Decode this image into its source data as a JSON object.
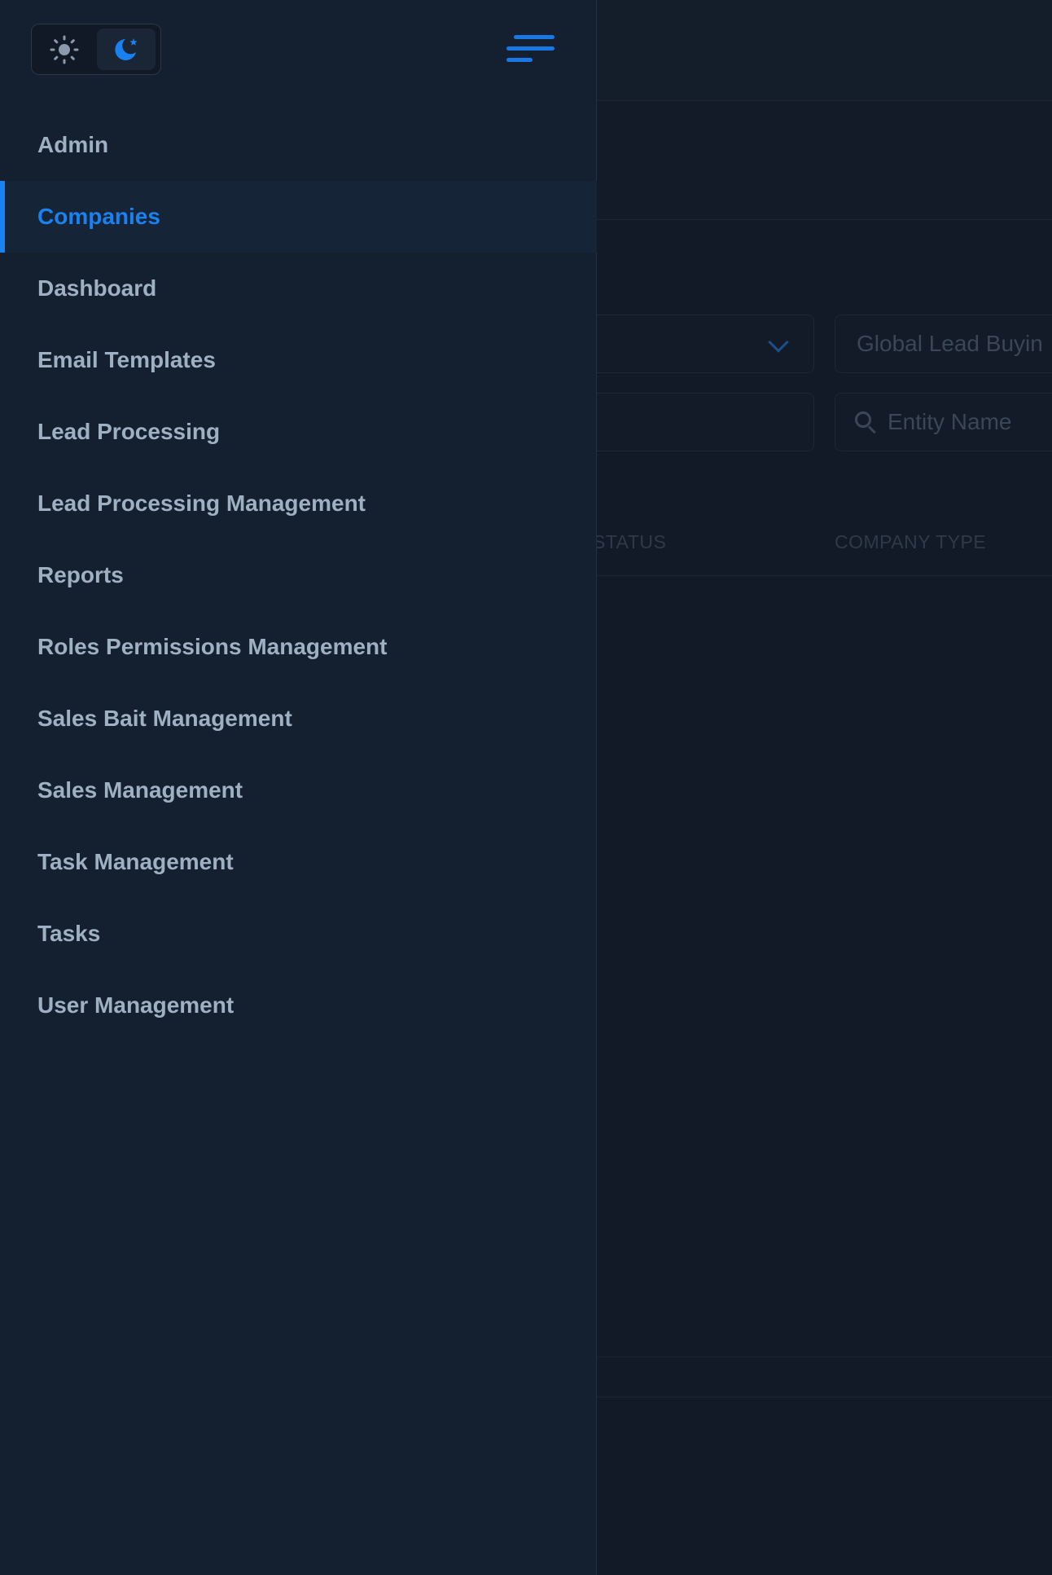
{
  "theme_toggle": {
    "options": [
      {
        "name": "light",
        "icon": "sun-icon",
        "active": false
      },
      {
        "name": "dark",
        "icon": "moon-icon",
        "active": true
      }
    ]
  },
  "menu_toggle": {
    "icon": "hamburger-menu-icon"
  },
  "sidebar": {
    "active_item": "Companies",
    "items": [
      {
        "label": "Admin"
      },
      {
        "label": "Companies"
      },
      {
        "label": "Dashboard"
      },
      {
        "label": "Email Templates"
      },
      {
        "label": "Lead Processing"
      },
      {
        "label": "Lead Processing Management"
      },
      {
        "label": "Reports"
      },
      {
        "label": "Roles Permissions Management"
      },
      {
        "label": "Sales Bait Management"
      },
      {
        "label": "Sales Management"
      },
      {
        "label": "Task Management"
      },
      {
        "label": "Tasks"
      },
      {
        "label": "User Management"
      }
    ]
  },
  "filters": {
    "buyer_value": "Global Lead Buyin",
    "entity_placeholder": "Entity Name"
  },
  "table": {
    "columns": [
      "STATUS",
      "COMPANY TYPE"
    ]
  },
  "colors": {
    "accent": "#1a82f0",
    "drawer_bg": "#142030",
    "page_bg": "#111a26",
    "nav_text": "#9fb0c2"
  }
}
